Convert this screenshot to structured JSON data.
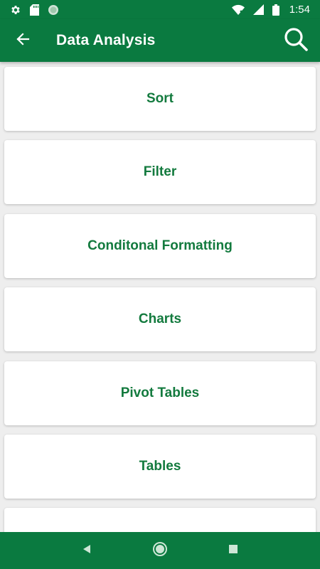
{
  "status_bar": {
    "time": "1:54",
    "left_icons": [
      "gear-icon",
      "sd-card-icon",
      "sync-circle-icon"
    ],
    "right_icons": [
      "wifi-icon",
      "signal-icon",
      "battery-icon"
    ]
  },
  "app_bar": {
    "title": "Data Analysis",
    "back_icon": "arrow-left-icon",
    "search_icon": "search-icon"
  },
  "colors": {
    "primary": "#0a7a40",
    "card_text": "#137a3e",
    "background": "#eeeeee",
    "card": "#ffffff"
  },
  "list": {
    "items": [
      {
        "label": "Sort"
      },
      {
        "label": "Filter"
      },
      {
        "label": "Conditonal Formatting"
      },
      {
        "label": "Charts"
      },
      {
        "label": "Pivot Tables"
      },
      {
        "label": "Tables"
      },
      {
        "label": ""
      }
    ]
  },
  "nav_bar": {
    "icons": [
      "back-triangle-icon",
      "home-circle-icon",
      "recents-square-icon"
    ]
  }
}
